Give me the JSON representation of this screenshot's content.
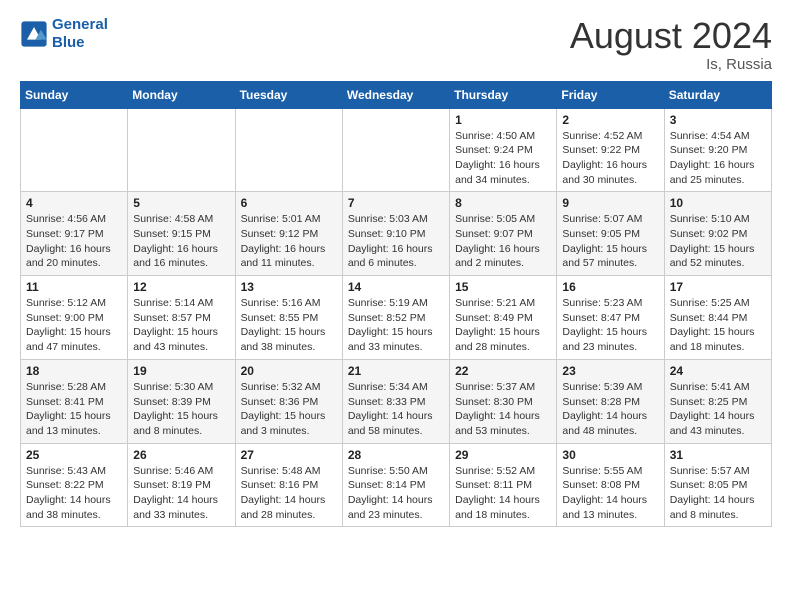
{
  "header": {
    "logo_line1": "General",
    "logo_line2": "Blue",
    "month_year": "August 2024",
    "location": "Is, Russia"
  },
  "weekdays": [
    "Sunday",
    "Monday",
    "Tuesday",
    "Wednesday",
    "Thursday",
    "Friday",
    "Saturday"
  ],
  "weeks": [
    [
      {
        "day": "",
        "info": ""
      },
      {
        "day": "",
        "info": ""
      },
      {
        "day": "",
        "info": ""
      },
      {
        "day": "",
        "info": ""
      },
      {
        "day": "1",
        "info": "Sunrise: 4:50 AM\nSunset: 9:24 PM\nDaylight: 16 hours\nand 34 minutes."
      },
      {
        "day": "2",
        "info": "Sunrise: 4:52 AM\nSunset: 9:22 PM\nDaylight: 16 hours\nand 30 minutes."
      },
      {
        "day": "3",
        "info": "Sunrise: 4:54 AM\nSunset: 9:20 PM\nDaylight: 16 hours\nand 25 minutes."
      }
    ],
    [
      {
        "day": "4",
        "info": "Sunrise: 4:56 AM\nSunset: 9:17 PM\nDaylight: 16 hours\nand 20 minutes."
      },
      {
        "day": "5",
        "info": "Sunrise: 4:58 AM\nSunset: 9:15 PM\nDaylight: 16 hours\nand 16 minutes."
      },
      {
        "day": "6",
        "info": "Sunrise: 5:01 AM\nSunset: 9:12 PM\nDaylight: 16 hours\nand 11 minutes."
      },
      {
        "day": "7",
        "info": "Sunrise: 5:03 AM\nSunset: 9:10 PM\nDaylight: 16 hours\nand 6 minutes."
      },
      {
        "day": "8",
        "info": "Sunrise: 5:05 AM\nSunset: 9:07 PM\nDaylight: 16 hours\nand 2 minutes."
      },
      {
        "day": "9",
        "info": "Sunrise: 5:07 AM\nSunset: 9:05 PM\nDaylight: 15 hours\nand 57 minutes."
      },
      {
        "day": "10",
        "info": "Sunrise: 5:10 AM\nSunset: 9:02 PM\nDaylight: 15 hours\nand 52 minutes."
      }
    ],
    [
      {
        "day": "11",
        "info": "Sunrise: 5:12 AM\nSunset: 9:00 PM\nDaylight: 15 hours\nand 47 minutes."
      },
      {
        "day": "12",
        "info": "Sunrise: 5:14 AM\nSunset: 8:57 PM\nDaylight: 15 hours\nand 43 minutes."
      },
      {
        "day": "13",
        "info": "Sunrise: 5:16 AM\nSunset: 8:55 PM\nDaylight: 15 hours\nand 38 minutes."
      },
      {
        "day": "14",
        "info": "Sunrise: 5:19 AM\nSunset: 8:52 PM\nDaylight: 15 hours\nand 33 minutes."
      },
      {
        "day": "15",
        "info": "Sunrise: 5:21 AM\nSunset: 8:49 PM\nDaylight: 15 hours\nand 28 minutes."
      },
      {
        "day": "16",
        "info": "Sunrise: 5:23 AM\nSunset: 8:47 PM\nDaylight: 15 hours\nand 23 minutes."
      },
      {
        "day": "17",
        "info": "Sunrise: 5:25 AM\nSunset: 8:44 PM\nDaylight: 15 hours\nand 18 minutes."
      }
    ],
    [
      {
        "day": "18",
        "info": "Sunrise: 5:28 AM\nSunset: 8:41 PM\nDaylight: 15 hours\nand 13 minutes."
      },
      {
        "day": "19",
        "info": "Sunrise: 5:30 AM\nSunset: 8:39 PM\nDaylight: 15 hours\nand 8 minutes."
      },
      {
        "day": "20",
        "info": "Sunrise: 5:32 AM\nSunset: 8:36 PM\nDaylight: 15 hours\nand 3 minutes."
      },
      {
        "day": "21",
        "info": "Sunrise: 5:34 AM\nSunset: 8:33 PM\nDaylight: 14 hours\nand 58 minutes."
      },
      {
        "day": "22",
        "info": "Sunrise: 5:37 AM\nSunset: 8:30 PM\nDaylight: 14 hours\nand 53 minutes."
      },
      {
        "day": "23",
        "info": "Sunrise: 5:39 AM\nSunset: 8:28 PM\nDaylight: 14 hours\nand 48 minutes."
      },
      {
        "day": "24",
        "info": "Sunrise: 5:41 AM\nSunset: 8:25 PM\nDaylight: 14 hours\nand 43 minutes."
      }
    ],
    [
      {
        "day": "25",
        "info": "Sunrise: 5:43 AM\nSunset: 8:22 PM\nDaylight: 14 hours\nand 38 minutes."
      },
      {
        "day": "26",
        "info": "Sunrise: 5:46 AM\nSunset: 8:19 PM\nDaylight: 14 hours\nand 33 minutes."
      },
      {
        "day": "27",
        "info": "Sunrise: 5:48 AM\nSunset: 8:16 PM\nDaylight: 14 hours\nand 28 minutes."
      },
      {
        "day": "28",
        "info": "Sunrise: 5:50 AM\nSunset: 8:14 PM\nDaylight: 14 hours\nand 23 minutes."
      },
      {
        "day": "29",
        "info": "Sunrise: 5:52 AM\nSunset: 8:11 PM\nDaylight: 14 hours\nand 18 minutes."
      },
      {
        "day": "30",
        "info": "Sunrise: 5:55 AM\nSunset: 8:08 PM\nDaylight: 14 hours\nand 13 minutes."
      },
      {
        "day": "31",
        "info": "Sunrise: 5:57 AM\nSunset: 8:05 PM\nDaylight: 14 hours\nand 8 minutes."
      }
    ]
  ]
}
